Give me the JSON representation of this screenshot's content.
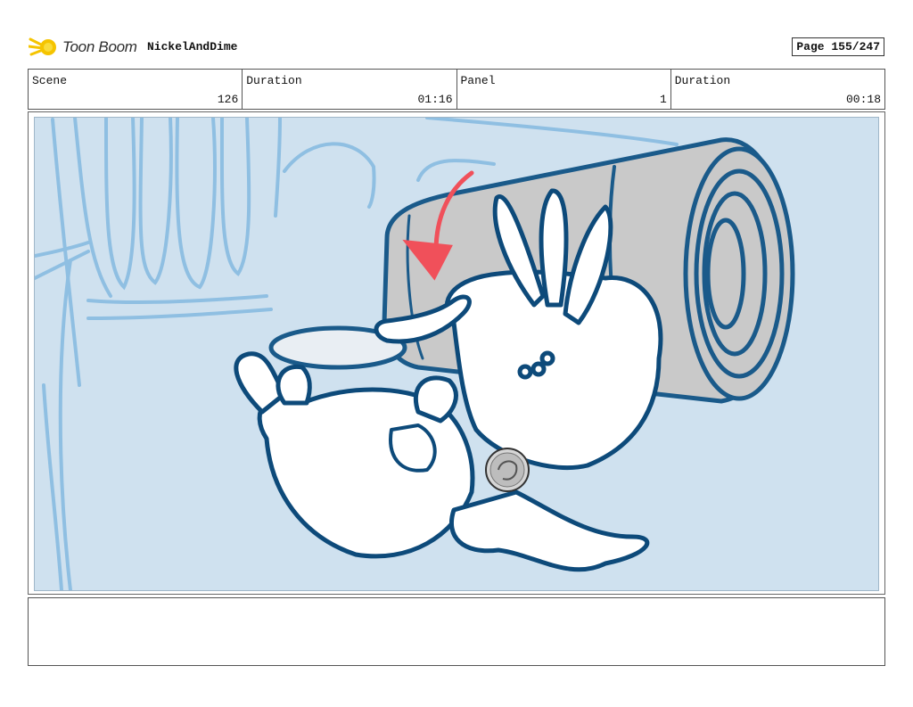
{
  "header": {
    "logo_text": "Toon Boom",
    "project": "NickelAndDime",
    "page": "Page 155/247"
  },
  "info": {
    "scene_label": "Scene",
    "scene_value": "126",
    "duration1_label": "Duration",
    "duration1_value": "01:16",
    "panel_label": "Panel",
    "panel_value": "1",
    "duration2_label": "Duration",
    "duration2_value": "00:18"
  },
  "panel": {
    "background_color": "#cfe1ef",
    "can_color": "#c9c9c9",
    "line_color": "#1a5a8a",
    "arrow_color": "#f0505a",
    "icons": [
      "toon-boom-logo-icon",
      "rabbit-sketch",
      "dime-coin-icon",
      "motion-arrow-icon"
    ]
  },
  "notes": {
    "text": ""
  }
}
